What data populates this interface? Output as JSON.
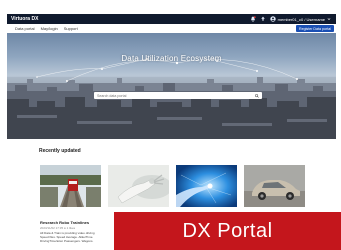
{
  "header": {
    "brand": "Virtuora DX",
    "user": "member01_c0 / Username",
    "icons": [
      "notification-icon",
      "upload-icon",
      "user-icon",
      "chevron-down-icon"
    ]
  },
  "nav": {
    "items": [
      "Data portal",
      "May/login",
      "Support"
    ],
    "register_label": "Register Data portal"
  },
  "hero": {
    "title": "Data Utilization Ecosystem",
    "search_placeholder": "Search data portal"
  },
  "recently_updated": {
    "title": "Recently updated",
    "cards": [
      {
        "name": "Railway",
        "colors": {
          "sky": "#dfe6ea",
          "train": "#b41e1e"
        }
      },
      {
        "name": "Robot",
        "colors": {
          "bg": "#e9ebe8",
          "arm": "#f5f5f3"
        }
      },
      {
        "name": "Digital",
        "colors": {
          "bg": "#1c73c8",
          "glow": "#bfe6ff"
        }
      },
      {
        "name": "Car",
        "colors": {
          "bg": "#a9a9a5",
          "car": "#c8bfae"
        }
      }
    ],
    "first_card": {
      "title": "Research Robo Trainlines",
      "meta": "2023/11/02 17:35 ● 1 likes",
      "description": "All Data & Train is providing video driving Speed files. Speed Average. Alike/Time. DrivingTime/total. Passengers. Wagons."
    }
  },
  "banner": {
    "text": "DX Portal",
    "color": "#c4161c"
  }
}
